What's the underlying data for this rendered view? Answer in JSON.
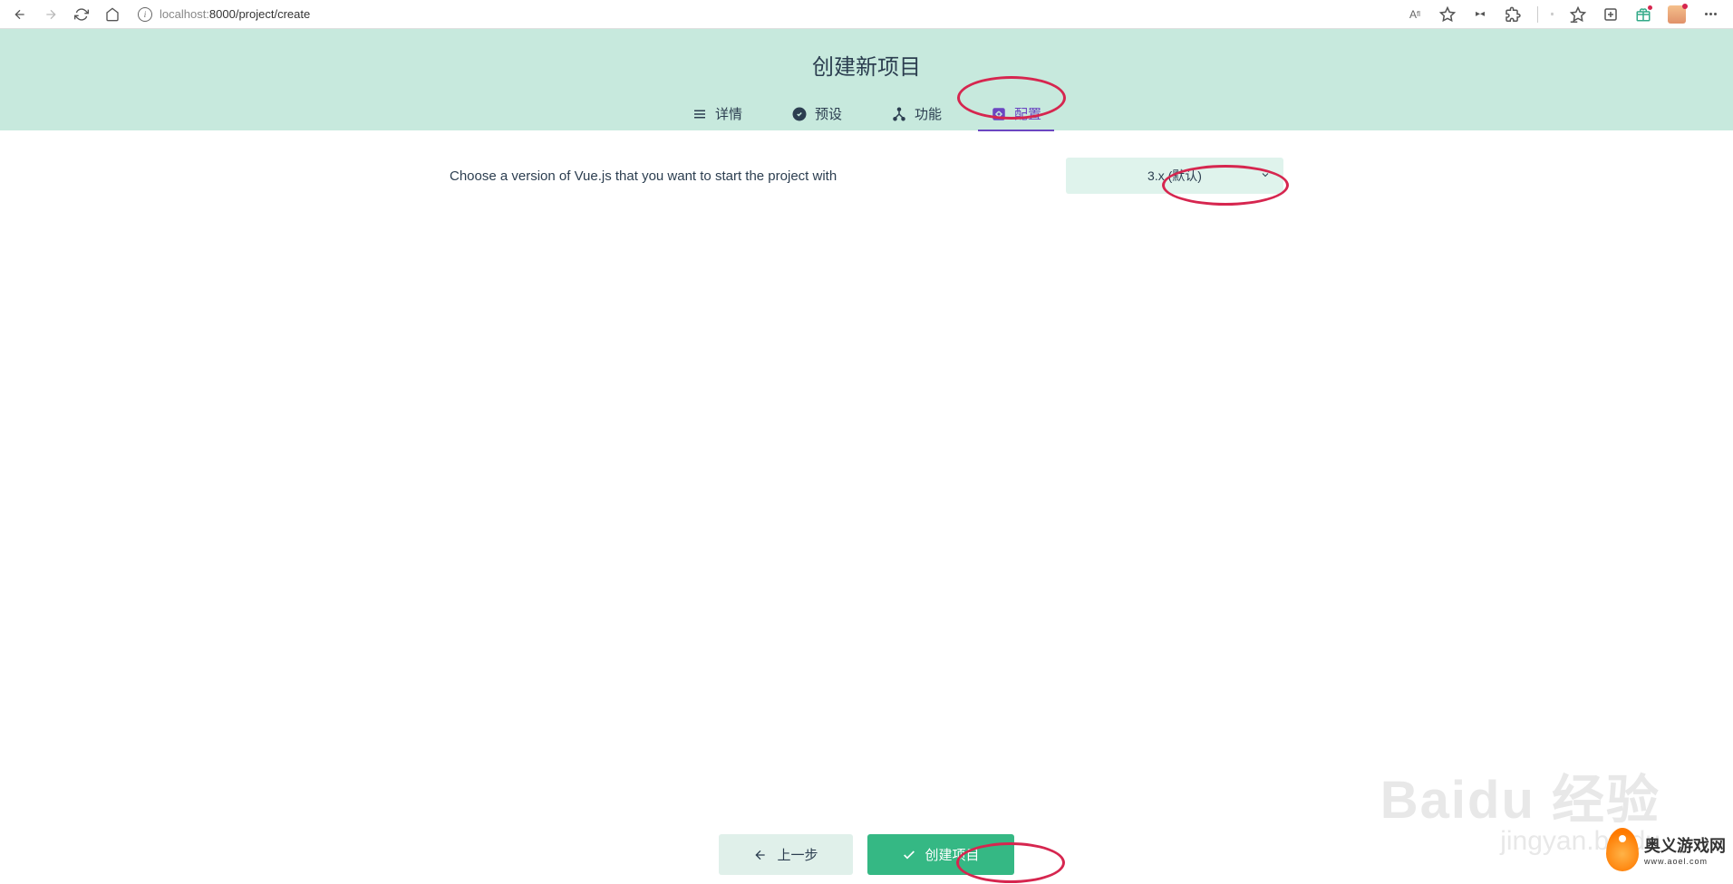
{
  "browser": {
    "url_host": "localhost:",
    "url_port_path": "8000/project/create"
  },
  "header": {
    "title": "创建新项目"
  },
  "tabs": {
    "details": "详情",
    "presets": "预设",
    "features": "功能",
    "config": "配置"
  },
  "config": {
    "vue_version_prompt": "Choose a version of Vue.js that you want to start the project with",
    "selected_version": "3.x (默认)"
  },
  "footer": {
    "back": "上一步",
    "create": "创建项目"
  },
  "watermark": {
    "line1": "Baidu 经验",
    "line2": "jingyan.baidu"
  },
  "logo": {
    "cn": "奥义游戏网",
    "en": "www.aoel.com"
  }
}
